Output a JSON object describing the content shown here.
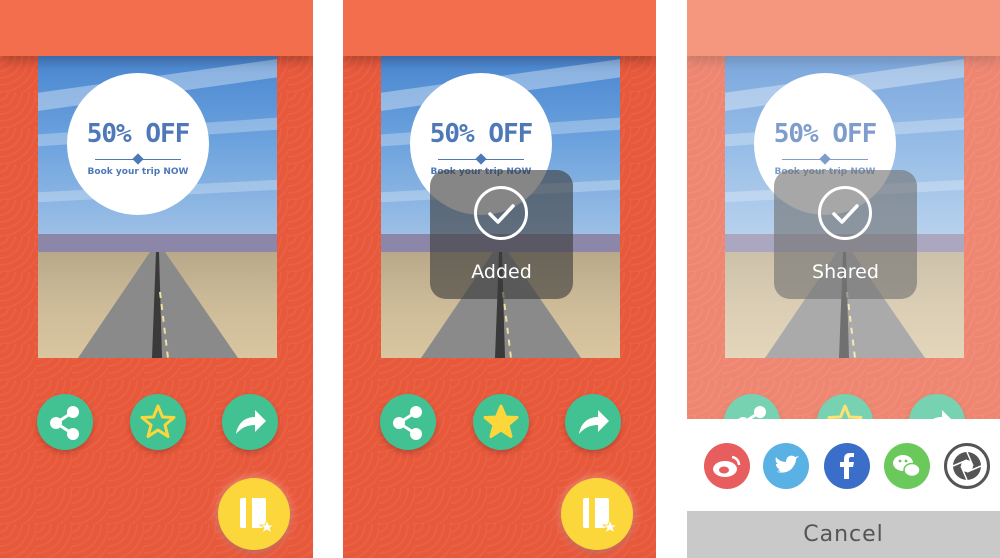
{
  "promo": {
    "headline": "50% OFF",
    "subline": "Book your trip NOW"
  },
  "toasts": {
    "added": "Added",
    "shared": "Shared"
  },
  "share_sheet": {
    "targets": [
      "weibo",
      "twitter",
      "facebook",
      "wechat",
      "camera-shutter"
    ],
    "cancel_label": "Cancel"
  },
  "colors": {
    "header": "#f26e4d",
    "background": "#e8583b",
    "action_button": "#42c193",
    "star_active": "#fbd73c",
    "fab": "#fbd73c",
    "promo_text": "#4e78b8",
    "weibo": "#e85d5d",
    "twitter": "#5ab1e4",
    "facebook": "#3b6ec8",
    "wechat": "#6ac95a",
    "camera": "#555555"
  },
  "icons": {
    "share": "share-icon",
    "favorite": "star-icon",
    "forward": "forward-arrow-icon",
    "fab": "bookmark-icon",
    "check": "check-icon"
  }
}
